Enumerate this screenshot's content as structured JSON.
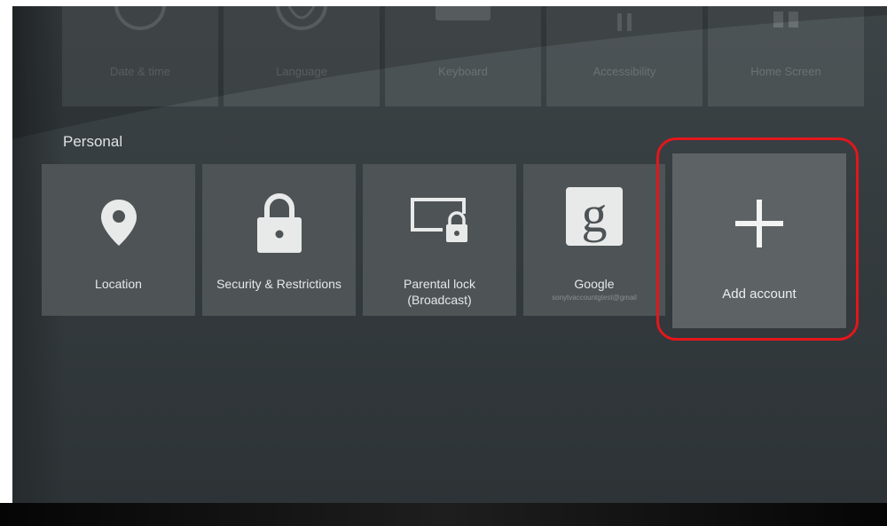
{
  "top_row": [
    {
      "label": "Date & time",
      "icon": "clock-icon"
    },
    {
      "label": "Language",
      "icon": "globe-icon"
    },
    {
      "label": "Keyboard",
      "icon": "keyboard-icon"
    },
    {
      "label": "Accessibility",
      "icon": "accessibility-icon"
    },
    {
      "label": "Home Screen",
      "icon": "home-screen-icon"
    }
  ],
  "personal": {
    "title": "Personal",
    "tiles": [
      {
        "label": "Location",
        "icon": "location-pin-icon"
      },
      {
        "label": "Security & Restrictions",
        "icon": "lock-icon"
      },
      {
        "label": "Parental lock",
        "label2": "(Broadcast)",
        "icon": "screen-lock-icon"
      },
      {
        "label": "Google",
        "sublabel": "sonytvaccountgtest@gmail",
        "icon": "google-g-icon"
      }
    ],
    "add_account": {
      "label": "Add account",
      "icon": "plus-icon"
    }
  },
  "colors": {
    "highlight": "#e3161c",
    "tile": "#4e5456",
    "screen": "#353c3f"
  }
}
